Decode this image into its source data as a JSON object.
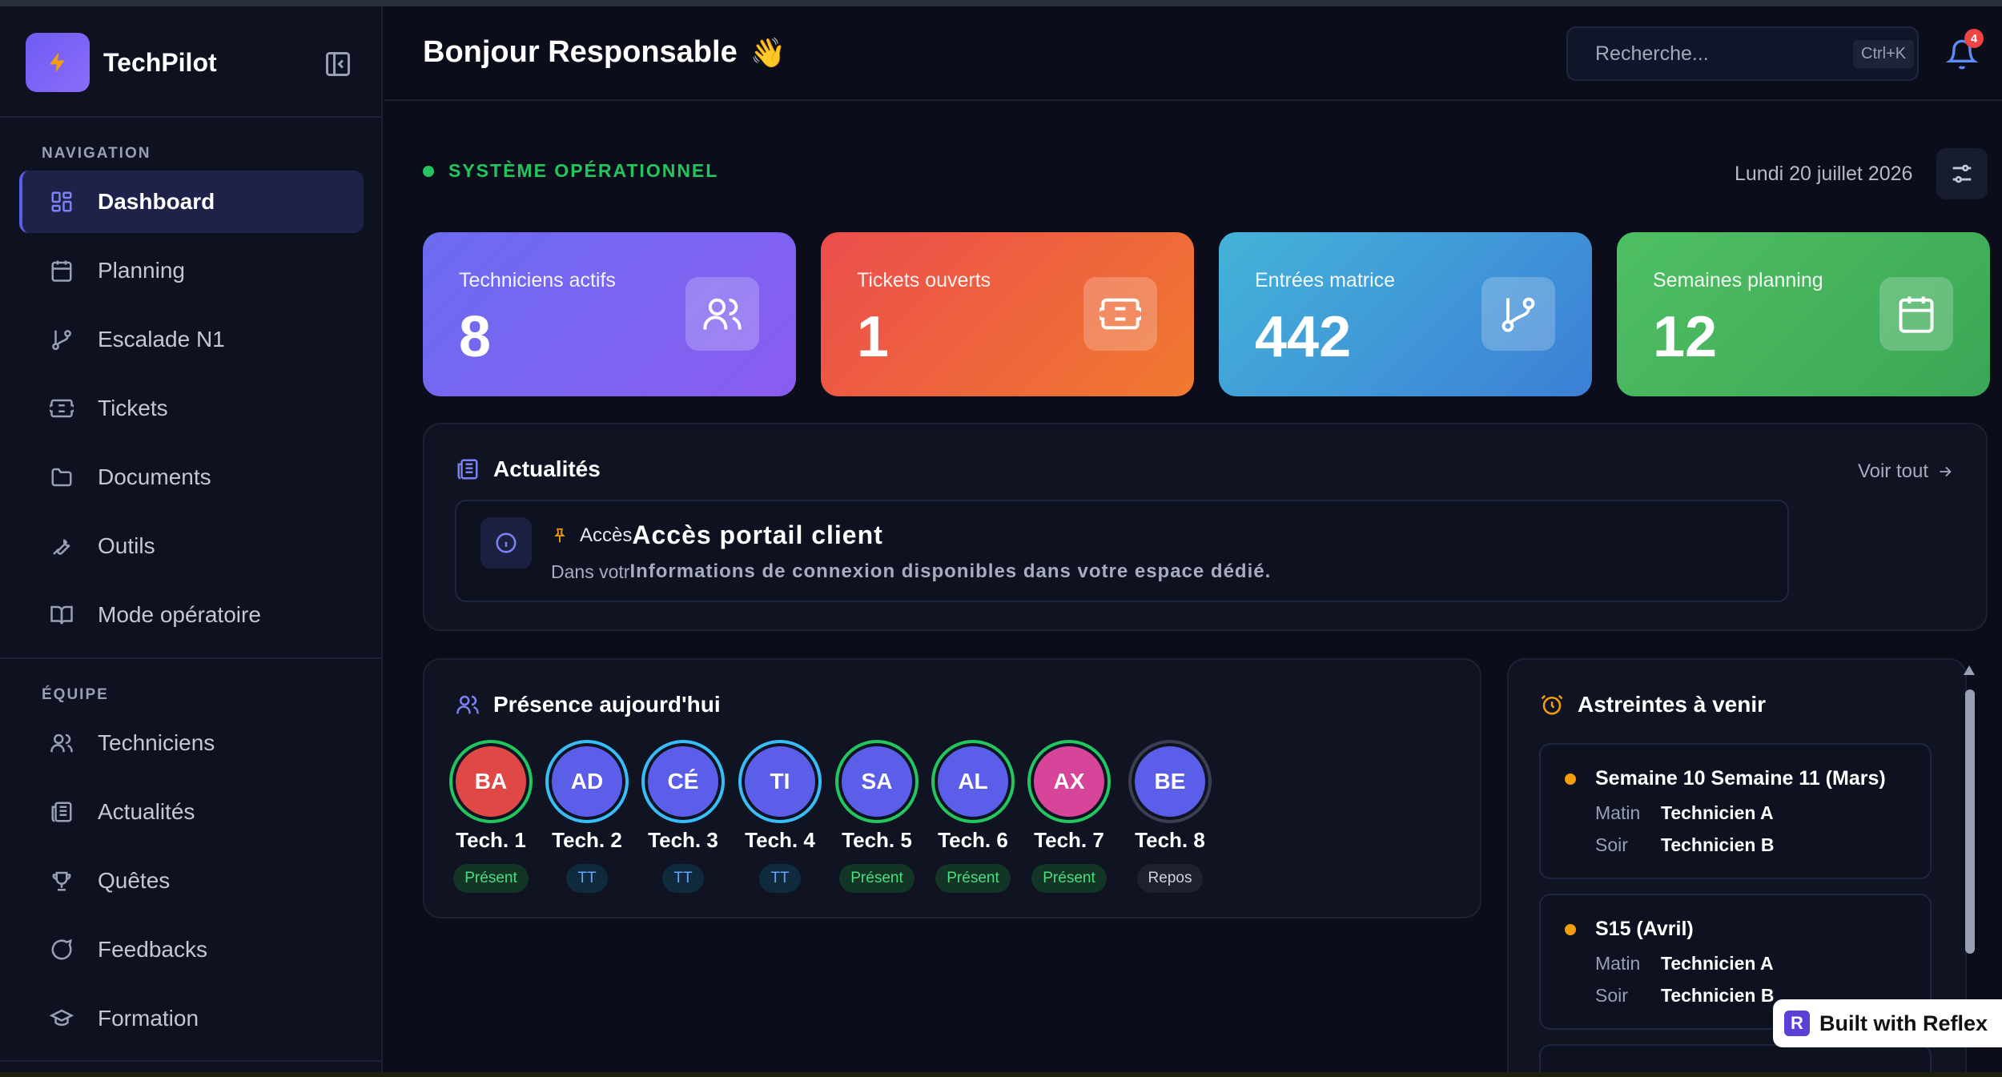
{
  "brand": {
    "name": "TechPilot"
  },
  "sidebar": {
    "nav_label": "NAVIGATION",
    "nav_items": [
      {
        "label": "Dashboard",
        "icon": "dashboard-icon",
        "active": true
      },
      {
        "label": "Planning",
        "icon": "calendar-icon"
      },
      {
        "label": "Escalade N1",
        "icon": "git-branch-icon"
      },
      {
        "label": "Tickets",
        "icon": "ticket-icon"
      },
      {
        "label": "Documents",
        "icon": "folder-icon"
      },
      {
        "label": "Outils",
        "icon": "wrench-icon"
      },
      {
        "label": "Mode opératoire",
        "icon": "book-icon"
      }
    ],
    "team_label": "ÉQUIPE",
    "team_items": [
      {
        "label": "Techniciens",
        "icon": "users-icon"
      },
      {
        "label": "Actualités",
        "icon": "newspaper-icon"
      },
      {
        "label": "Quêtes",
        "icon": "trophy-icon"
      },
      {
        "label": "Feedbacks",
        "icon": "message-icon"
      },
      {
        "label": "Formation",
        "icon": "graduation-cap-icon"
      }
    ]
  },
  "header": {
    "greeting": "Bonjour Responsable",
    "wave": "👋",
    "search_placeholder": "Recherche...",
    "shortcut": "Ctrl+K",
    "notifications_count": "4"
  },
  "status": {
    "text": "SYSTÈME OPÉRATIONNEL",
    "date": "Lundi 20 juillet 2026",
    "color": "#22c55e"
  },
  "stats": [
    {
      "label": "Techniciens actifs",
      "value": "8",
      "icon": "users-icon",
      "gradient": [
        "#6b6cf0",
        "#8a5cf0"
      ]
    },
    {
      "label": "Tickets ouverts",
      "value": "1",
      "icon": "ticket-icon",
      "gradient": [
        "#ec4d4d",
        "#f0792f"
      ]
    },
    {
      "label": "Entrées matrice",
      "value": "442",
      "icon": "git-branch-icon",
      "gradient": [
        "#44b3d8",
        "#3c7fd6"
      ]
    },
    {
      "label": "Semaines planning",
      "value": "12",
      "icon": "calendar-icon",
      "gradient": [
        "#4fbf62",
        "#3aa757"
      ]
    }
  ],
  "news": {
    "title": "Actualités",
    "see_all": "Voir tout",
    "item": {
      "title_prefix": "Accès",
      "title": "Accès portail client",
      "subtitle_prefix": "Dans votr",
      "body": "Informations de connexion disponibles dans votre espace dédié."
    }
  },
  "presence": {
    "title": "Présence aujourd'hui",
    "people": [
      {
        "initials": "BA",
        "name": "Tech. 1",
        "status": "Présent",
        "kind": "present",
        "color": "#e04848"
      },
      {
        "initials": "AD",
        "name": "Tech. 2",
        "status": "TT",
        "kind": "tt",
        "color": "#5b5ee8"
      },
      {
        "initials": "CÉ",
        "name": "Tech. 3",
        "status": "TT",
        "kind": "tt",
        "color": "#5b5ee8"
      },
      {
        "initials": "TI",
        "name": "Tech. 4",
        "status": "TT",
        "kind": "tt",
        "color": "#5b5ee8"
      },
      {
        "initials": "SA",
        "name": "Tech. 5",
        "status": "Présent",
        "kind": "present",
        "color": "#5b5ee8"
      },
      {
        "initials": "AL",
        "name": "Tech. 6",
        "status": "Présent",
        "kind": "present",
        "color": "#5b5ee8"
      },
      {
        "initials": "AX",
        "name": "Tech. 7",
        "status": "Présent",
        "kind": "present",
        "color": "#d6459a"
      },
      {
        "initials": "BE",
        "name": "Tech. 8",
        "status": "Repos",
        "kind": "repos",
        "color": "#5b5ee8"
      }
    ]
  },
  "duties": {
    "title": "Astreintes à venir",
    "items": [
      {
        "title": "Semaine 10 Semaine 11 (Mars)",
        "morning_label": "Matin",
        "morning": "Technicien A",
        "evening_label": "Soir",
        "evening": "Technicien B"
      },
      {
        "title": "S15 (Avril)",
        "morning_label": "Matin",
        "morning": "Technicien A",
        "evening_label": "Soir",
        "evening": "Technicien B"
      }
    ]
  },
  "footer_badge": {
    "logo": "R",
    "text": "Built with Reflex"
  }
}
